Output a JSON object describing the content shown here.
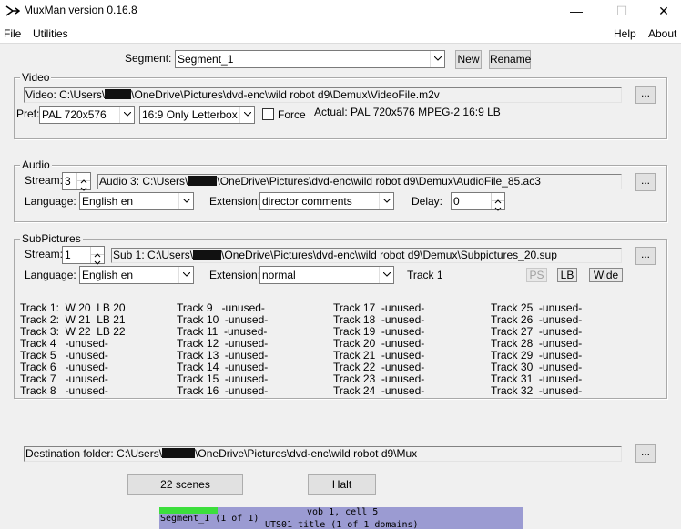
{
  "window": {
    "title": "MuxMan version 0.16.8",
    "minimize_icon": "minimize-icon",
    "maximize_icon": "maximize-icon",
    "close_icon": "close-icon"
  },
  "menu": {
    "file": "File",
    "utilities": "Utilities",
    "help": "Help",
    "about": "About"
  },
  "segment": {
    "label": "Segment:",
    "value": "Segment_1",
    "new_label": "New",
    "rename_label": "Rename"
  },
  "video": {
    "group_label": "Video",
    "path": "Video: C:\\Users\\",
    "path_rest": "\\OneDrive\\Pictures\\dvd-enc\\wild robot d9\\Demux\\VideoFile.m2v",
    "browse_label": "...",
    "pref_label": "Pref:",
    "pref_value": "PAL  720x576",
    "aspect_value": "16:9 Only Letterbox",
    "force_label": "Force",
    "actual": "Actual: PAL  720x576  MPEG-2  16:9 LB"
  },
  "audio": {
    "group_label": "Audio",
    "stream_label": "Stream:",
    "stream_value": "3",
    "path": "Audio 3: C:\\Users\\",
    "path_rest": "\\OneDrive\\Pictures\\dvd-enc\\wild robot d9\\Demux\\AudioFile_85.ac3",
    "browse_label": "...",
    "language_label": "Language:",
    "language_value": "English en",
    "extension_label": "Extension:",
    "extension_value": "director comments",
    "delay_label": "Delay:",
    "delay_value": "0"
  },
  "subpictures": {
    "group_label": "SubPictures",
    "stream_label": "Stream:",
    "stream_value": "1",
    "path": "Sub 1: C:\\Users\\",
    "path_rest": "\\OneDrive\\Pictures\\dvd-enc\\wild robot d9\\Demux\\Subpictures_20.sup",
    "browse_label": "...",
    "language_label": "Language:",
    "language_value": "English en",
    "extension_label": "Extension:",
    "extension_value": "normal",
    "track_label": "Track 1",
    "ps_label": "PS",
    "lb_label": "LB",
    "wide_label": "Wide",
    "tracks": [
      [
        "Track 1:  W 20  LB 20",
        "Track 9   -unused-",
        "Track 17  -unused-",
        "Track 25  -unused-"
      ],
      [
        "Track 2:  W 21  LB 21",
        "Track 10  -unused-",
        "Track 18  -unused-",
        "Track 26  -unused-"
      ],
      [
        "Track 3:  W 22  LB 22",
        "Track 11  -unused-",
        "Track 19  -unused-",
        "Track 27  -unused-"
      ],
      [
        "Track 4   -unused-",
        "Track 12  -unused-",
        "Track 20  -unused-",
        "Track 28  -unused-"
      ],
      [
        "Track 5   -unused-",
        "Track 13  -unused-",
        "Track 21  -unused-",
        "Track 29  -unused-"
      ],
      [
        "Track 6   -unused-",
        "Track 14  -unused-",
        "Track 22  -unused-",
        "Track 30  -unused-"
      ],
      [
        "Track 7   -unused-",
        "Track 15  -unused-",
        "Track 23  -unused-",
        "Track 31  -unused-"
      ],
      [
        "Track 8   -unused-",
        "Track 16  -unused-",
        "Track 24  -unused-",
        "Track 32  -unused-"
      ]
    ]
  },
  "destination": {
    "path": "Destination folder: C:\\Users\\",
    "path_rest": "\\OneDrive\\Pictures\\dvd-enc\\wild robot d9\\Mux",
    "browse_label": "..."
  },
  "actions": {
    "scenes_label": "22 scenes",
    "halt_label": "Halt"
  },
  "status": {
    "line1_left": "",
    "line1_right": "vob 1, cell 5",
    "line2_left": "Segment_1 (1 of 1)",
    "line3": "UTS01 title (1 of 1 domains)",
    "progress": 0.16,
    "colors": {
      "bar": "#9b9bd2",
      "progress": "#3cde3c"
    }
  }
}
